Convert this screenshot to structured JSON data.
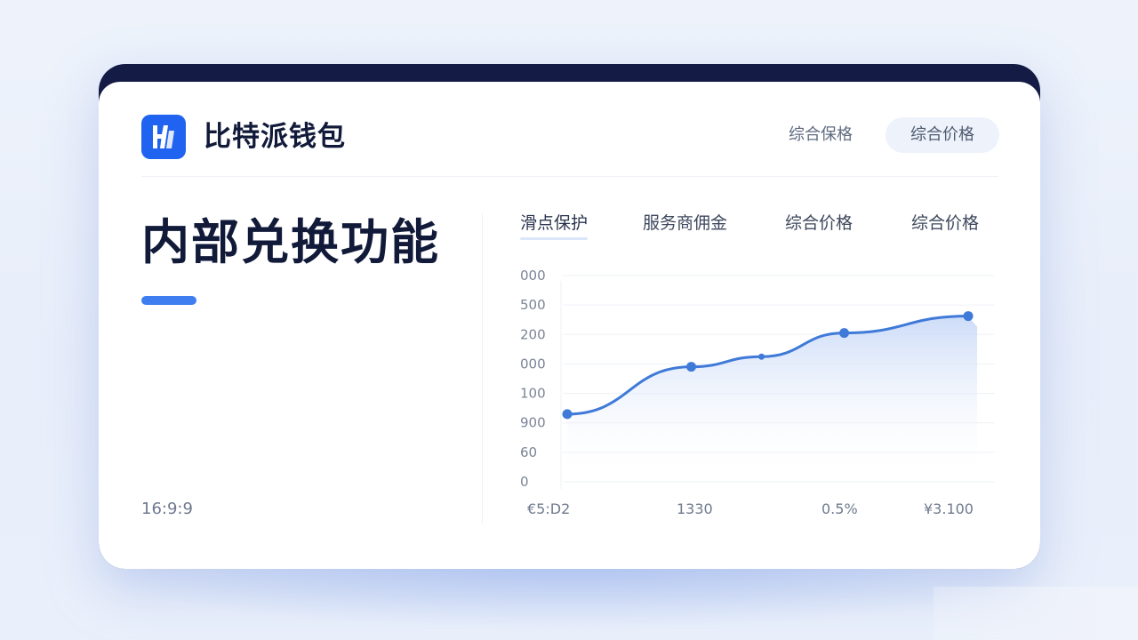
{
  "header": {
    "brand_name": "比特派钱包",
    "nav_link": "综合保格",
    "nav_pill": "综合价格"
  },
  "main": {
    "headline": "内部兑换功能",
    "timestamp": "16:9:9"
  },
  "tabs": [
    {
      "label": "滑点保护",
      "active": true
    },
    {
      "label": "服务商佣金",
      "active": false
    },
    {
      "label": "综合价格",
      "active": false
    },
    {
      "label": "综合价格",
      "active": false
    }
  ],
  "chart_data": {
    "type": "area",
    "y_tick_labels": [
      "000",
      "500",
      "200",
      "000",
      "100",
      "900",
      "60",
      "0"
    ],
    "x_tick_labels": [
      "€5:D2",
      "1330",
      "0.5%",
      "¥3.100"
    ],
    "series": [
      {
        "points": [
          [
            0,
            100
          ],
          [
            0.3,
            170
          ],
          [
            0.47,
            185
          ],
          [
            0.67,
            220
          ],
          [
            0.97,
            245
          ]
        ]
      }
    ]
  },
  "colors": {
    "brand": "#1f63f0",
    "accent": "#3f7ef0",
    "dark": "#141c45"
  }
}
